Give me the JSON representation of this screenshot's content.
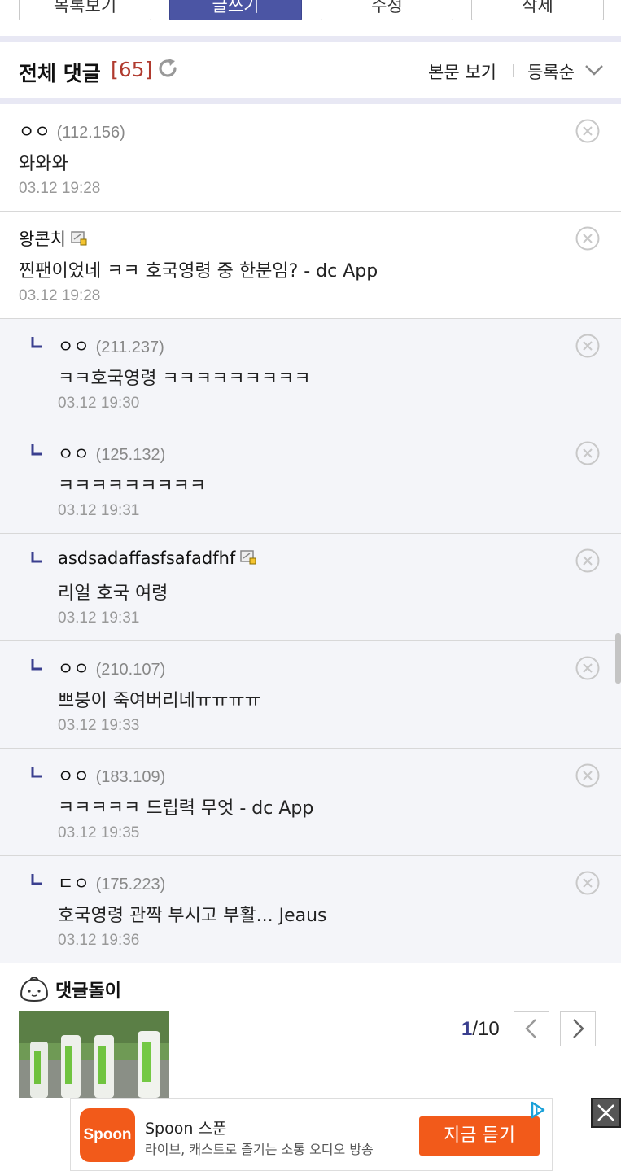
{
  "top_buttons": [
    {
      "label": "목록보기"
    },
    {
      "label": "글쓰기"
    },
    {
      "label": "수정"
    },
    {
      "label": "삭제"
    }
  ],
  "comments_header": {
    "title": "전체 댓글",
    "count": "[65]",
    "view_post": "본문 보기",
    "sort": "등록순"
  },
  "comments": [
    {
      "nick": "ㅇㅇ",
      "ip": "(112.156)",
      "text": "와와와",
      "date": "03.12 19:28",
      "reply": false,
      "memo": false
    },
    {
      "nick": "왕콘치",
      "ip": "",
      "text": "찐팬이었네 ㅋㅋ 호국영령 중 한분임? - dc App",
      "date": "03.12 19:28",
      "reply": false,
      "memo": true
    },
    {
      "nick": "ㅇㅇ",
      "ip": "(211.237)",
      "text": "ㅋㅋ호국영령 ㅋㅋㅋㅋㅋㅋㅋㅋㅋ",
      "date": "03.12 19:30",
      "reply": true,
      "memo": false
    },
    {
      "nick": "ㅇㅇ",
      "ip": "(125.132)",
      "text": "ㅋㅋㅋㅋㅋㅋㅋㅋㅋ",
      "date": "03.12 19:31",
      "reply": true,
      "memo": false
    },
    {
      "nick": "asdsadaffasfsafadfhf",
      "ip": "",
      "text": "리얼 호국 여령",
      "date": "03.12 19:31",
      "reply": true,
      "memo": true
    },
    {
      "nick": "ㅇㅇ",
      "ip": "(210.107)",
      "text": "쁘붕이 죽여버리네ㅠㅠㅠㅠ",
      "date": "03.12 19:33",
      "reply": true,
      "memo": false
    },
    {
      "nick": "ㅇㅇ",
      "ip": "(183.109)",
      "text": "ㅋㅋㅋㅋㅋ 드립력 무엇 - dc App",
      "date": "03.12 19:35",
      "reply": true,
      "memo": false
    },
    {
      "nick": "ㄷㅇ",
      "ip": "(175.223)",
      "text": "호국영령 관짝 부시고 부활... Jeaus",
      "date": "03.12 19:36",
      "reply": true,
      "memo": false
    }
  ],
  "bot": {
    "title": "댓글돌이",
    "page_current": "1",
    "page_total": "/10"
  },
  "ad": {
    "logo_text": "Spoon",
    "title": "Spoon 스푼",
    "description": "라이브, 캐스트로 즐기는 소통 오디오 방송",
    "cta": "지금 듣기"
  },
  "colors": {
    "primary": "#4b55a4",
    "count_red": "#b03a2e",
    "reply_bg": "#f4f5f9",
    "ad_orange": "#f25a1a"
  }
}
